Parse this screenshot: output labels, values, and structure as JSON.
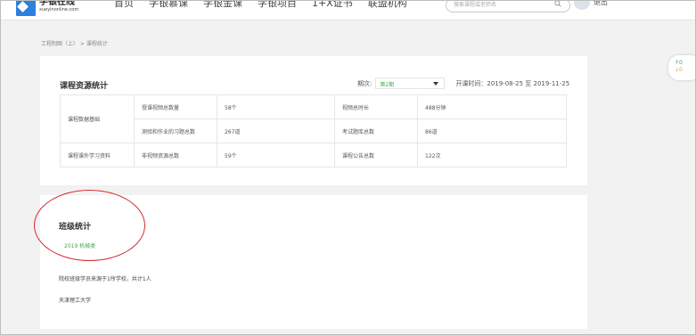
{
  "header": {
    "logo": {
      "name": "学银在线",
      "url": "xueyinonline.com"
    },
    "nav": [
      "首页",
      "学银慕课",
      "学银金课",
      "学银项目",
      "1+X证书",
      "联盟机构"
    ],
    "search_placeholder": "搜索课程或老师名",
    "logout": "退出"
  },
  "breadcrumb": {
    "course": "工程制图（上）",
    "separator": " > ",
    "current": "课程统计"
  },
  "float_widget": {
    "up": "↑0",
    "down": "↓0"
  },
  "resource_stats": {
    "title": "课程资源统计",
    "term_label": "期次:",
    "term_value": "第2期",
    "course_time_label": "开课时间：",
    "course_time": "2019-08-25 至 2019-11-25",
    "rows": [
      {
        "category": "课程数据基础",
        "items": [
          {
            "label": "授课视频总数量",
            "value": "58个",
            "label2": "视频总时长",
            "value2": "488分钟"
          },
          {
            "label": "测验和作业的习题总数",
            "value": "267道",
            "label2": "考试题库总数",
            "value2": "86道"
          }
        ]
      },
      {
        "category": "课程课外学习资料",
        "items": [
          {
            "label": "非视频资源总数",
            "value": "59个",
            "label2": "课程公告总数",
            "value2": "122次"
          }
        ]
      }
    ]
  },
  "class_stats": {
    "title": "班级统计",
    "class_name": "2019 机械类",
    "summary": "院校班级学员来源于1所学校，共计1人",
    "school": "天津理工大学"
  },
  "colors": {
    "accent": "#46a84e",
    "annotation": "#d9262e",
    "logo": "#2d7fe0"
  }
}
